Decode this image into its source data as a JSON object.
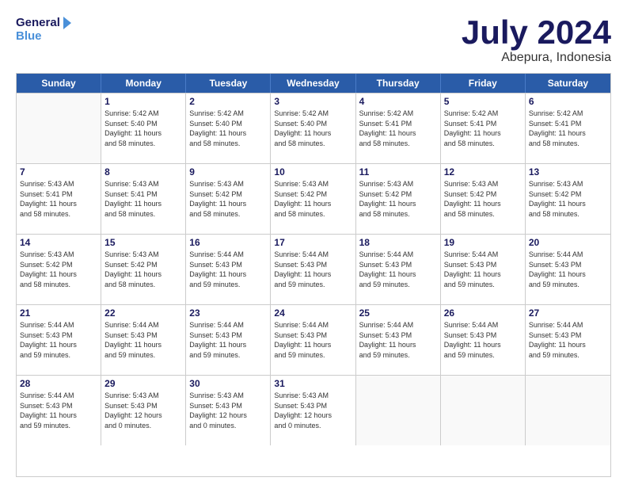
{
  "header": {
    "logo_general": "General",
    "logo_blue": "Blue",
    "month": "July 2024",
    "location": "Abepura, Indonesia"
  },
  "weekdays": [
    "Sunday",
    "Monday",
    "Tuesday",
    "Wednesday",
    "Thursday",
    "Friday",
    "Saturday"
  ],
  "rows": [
    [
      {
        "day": "",
        "lines": []
      },
      {
        "day": "1",
        "lines": [
          "Sunrise: 5:42 AM",
          "Sunset: 5:40 PM",
          "Daylight: 11 hours",
          "and 58 minutes."
        ]
      },
      {
        "day": "2",
        "lines": [
          "Sunrise: 5:42 AM",
          "Sunset: 5:40 PM",
          "Daylight: 11 hours",
          "and 58 minutes."
        ]
      },
      {
        "day": "3",
        "lines": [
          "Sunrise: 5:42 AM",
          "Sunset: 5:40 PM",
          "Daylight: 11 hours",
          "and 58 minutes."
        ]
      },
      {
        "day": "4",
        "lines": [
          "Sunrise: 5:42 AM",
          "Sunset: 5:41 PM",
          "Daylight: 11 hours",
          "and 58 minutes."
        ]
      },
      {
        "day": "5",
        "lines": [
          "Sunrise: 5:42 AM",
          "Sunset: 5:41 PM",
          "Daylight: 11 hours",
          "and 58 minutes."
        ]
      },
      {
        "day": "6",
        "lines": [
          "Sunrise: 5:42 AM",
          "Sunset: 5:41 PM",
          "Daylight: 11 hours",
          "and 58 minutes."
        ]
      }
    ],
    [
      {
        "day": "7",
        "lines": [
          "Sunrise: 5:43 AM",
          "Sunset: 5:41 PM",
          "Daylight: 11 hours",
          "and 58 minutes."
        ]
      },
      {
        "day": "8",
        "lines": [
          "Sunrise: 5:43 AM",
          "Sunset: 5:41 PM",
          "Daylight: 11 hours",
          "and 58 minutes."
        ]
      },
      {
        "day": "9",
        "lines": [
          "Sunrise: 5:43 AM",
          "Sunset: 5:42 PM",
          "Daylight: 11 hours",
          "and 58 minutes."
        ]
      },
      {
        "day": "10",
        "lines": [
          "Sunrise: 5:43 AM",
          "Sunset: 5:42 PM",
          "Daylight: 11 hours",
          "and 58 minutes."
        ]
      },
      {
        "day": "11",
        "lines": [
          "Sunrise: 5:43 AM",
          "Sunset: 5:42 PM",
          "Daylight: 11 hours",
          "and 58 minutes."
        ]
      },
      {
        "day": "12",
        "lines": [
          "Sunrise: 5:43 AM",
          "Sunset: 5:42 PM",
          "Daylight: 11 hours",
          "and 58 minutes."
        ]
      },
      {
        "day": "13",
        "lines": [
          "Sunrise: 5:43 AM",
          "Sunset: 5:42 PM",
          "Daylight: 11 hours",
          "and 58 minutes."
        ]
      }
    ],
    [
      {
        "day": "14",
        "lines": [
          "Sunrise: 5:43 AM",
          "Sunset: 5:42 PM",
          "Daylight: 11 hours",
          "and 58 minutes."
        ]
      },
      {
        "day": "15",
        "lines": [
          "Sunrise: 5:43 AM",
          "Sunset: 5:42 PM",
          "Daylight: 11 hours",
          "and 58 minutes."
        ]
      },
      {
        "day": "16",
        "lines": [
          "Sunrise: 5:44 AM",
          "Sunset: 5:43 PM",
          "Daylight: 11 hours",
          "and 59 minutes."
        ]
      },
      {
        "day": "17",
        "lines": [
          "Sunrise: 5:44 AM",
          "Sunset: 5:43 PM",
          "Daylight: 11 hours",
          "and 59 minutes."
        ]
      },
      {
        "day": "18",
        "lines": [
          "Sunrise: 5:44 AM",
          "Sunset: 5:43 PM",
          "Daylight: 11 hours",
          "and 59 minutes."
        ]
      },
      {
        "day": "19",
        "lines": [
          "Sunrise: 5:44 AM",
          "Sunset: 5:43 PM",
          "Daylight: 11 hours",
          "and 59 minutes."
        ]
      },
      {
        "day": "20",
        "lines": [
          "Sunrise: 5:44 AM",
          "Sunset: 5:43 PM",
          "Daylight: 11 hours",
          "and 59 minutes."
        ]
      }
    ],
    [
      {
        "day": "21",
        "lines": [
          "Sunrise: 5:44 AM",
          "Sunset: 5:43 PM",
          "Daylight: 11 hours",
          "and 59 minutes."
        ]
      },
      {
        "day": "22",
        "lines": [
          "Sunrise: 5:44 AM",
          "Sunset: 5:43 PM",
          "Daylight: 11 hours",
          "and 59 minutes."
        ]
      },
      {
        "day": "23",
        "lines": [
          "Sunrise: 5:44 AM",
          "Sunset: 5:43 PM",
          "Daylight: 11 hours",
          "and 59 minutes."
        ]
      },
      {
        "day": "24",
        "lines": [
          "Sunrise: 5:44 AM",
          "Sunset: 5:43 PM",
          "Daylight: 11 hours",
          "and 59 minutes."
        ]
      },
      {
        "day": "25",
        "lines": [
          "Sunrise: 5:44 AM",
          "Sunset: 5:43 PM",
          "Daylight: 11 hours",
          "and 59 minutes."
        ]
      },
      {
        "day": "26",
        "lines": [
          "Sunrise: 5:44 AM",
          "Sunset: 5:43 PM",
          "Daylight: 11 hours",
          "and 59 minutes."
        ]
      },
      {
        "day": "27",
        "lines": [
          "Sunrise: 5:44 AM",
          "Sunset: 5:43 PM",
          "Daylight: 11 hours",
          "and 59 minutes."
        ]
      }
    ],
    [
      {
        "day": "28",
        "lines": [
          "Sunrise: 5:44 AM",
          "Sunset: 5:43 PM",
          "Daylight: 11 hours",
          "and 59 minutes."
        ]
      },
      {
        "day": "29",
        "lines": [
          "Sunrise: 5:43 AM",
          "Sunset: 5:43 PM",
          "Daylight: 12 hours",
          "and 0 minutes."
        ]
      },
      {
        "day": "30",
        "lines": [
          "Sunrise: 5:43 AM",
          "Sunset: 5:43 PM",
          "Daylight: 12 hours",
          "and 0 minutes."
        ]
      },
      {
        "day": "31",
        "lines": [
          "Sunrise: 5:43 AM",
          "Sunset: 5:43 PM",
          "Daylight: 12 hours",
          "and 0 minutes."
        ]
      },
      {
        "day": "",
        "lines": []
      },
      {
        "day": "",
        "lines": []
      },
      {
        "day": "",
        "lines": []
      }
    ]
  ]
}
